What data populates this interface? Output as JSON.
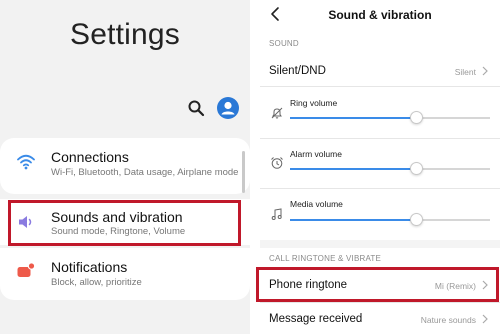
{
  "left": {
    "title": "Settings",
    "items": [
      {
        "label": "Connections",
        "sub": "Wi-Fi, Bluetooth, Data usage, Airplane mode",
        "icon": "wifi-icon",
        "icon_color": "#3a8be8"
      },
      {
        "label": "Sounds and vibration",
        "sub": "Sound mode, Ringtone, Volume",
        "icon": "speaker-icon",
        "icon_color": "#8a7be0"
      },
      {
        "label": "Notifications",
        "sub": "Block, allow, prioritize",
        "icon": "notification-icon",
        "icon_color": "#ee5a4a"
      }
    ],
    "highlighted_item": "Sounds and vibration",
    "accent": "#2a78d6"
  },
  "right": {
    "header": "Sound & vibration",
    "section_sound": "SOUND",
    "silent_label": "Silent/DND",
    "silent_value": "Silent",
    "ring_label": "Ring volume",
    "ring_level": 0.63,
    "alarm_label": "Alarm volume",
    "alarm_level": 0.63,
    "media_label": "Media volume",
    "media_level": 0.63,
    "section_call": "CALL RINGTONE & VIBRATE",
    "ringtone_label": "Phone ringtone",
    "ringtone_value": "Mi (Remix)",
    "message_label": "Message received",
    "message_value": "Nature sounds",
    "highlight_color": "#c0182a",
    "slider_color": "#3a8be8"
  }
}
